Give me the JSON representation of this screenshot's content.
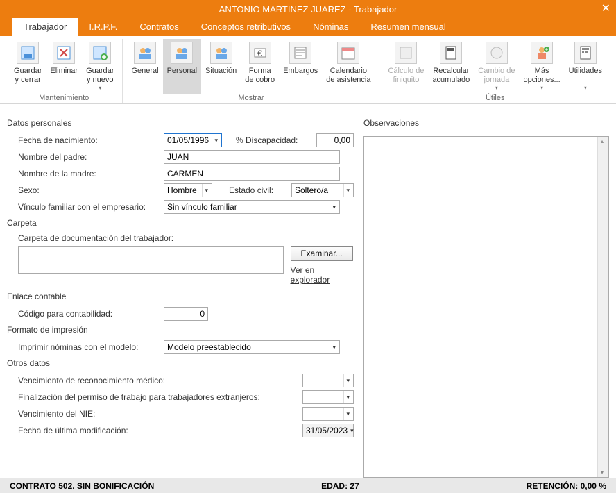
{
  "window": {
    "title": "ANTONIO MARTINEZ JUAREZ - Trabajador"
  },
  "tabs": {
    "trabajador": "Trabajador",
    "irpf": "I.R.P.F.",
    "contratos": "Contratos",
    "conceptos": "Conceptos retributivos",
    "nominas": "Nóminas",
    "resumen": "Resumen mensual"
  },
  "ribbon": {
    "mantenimiento": {
      "label": "Mantenimiento",
      "guardar_cerrar": "Guardar\ny cerrar",
      "eliminar": "Eliminar",
      "guardar_nuevo": "Guardar\ny nuevo"
    },
    "mostrar": {
      "label": "Mostrar",
      "general": "General",
      "personal": "Personal",
      "situacion": "Situación",
      "forma_cobro": "Forma\nde cobro",
      "embargos": "Embargos",
      "calendario": "Calendario\nde asistencia"
    },
    "utiles": {
      "label": "Útiles",
      "calculo": "Cálculo de\nfiniquito",
      "recalcular": "Recalcular\nacumulado",
      "cambio": "Cambio de\njornada",
      "mas": "Más\nopciones...",
      "utilidades": "Utilidades"
    }
  },
  "form": {
    "datos_personales": "Datos personales",
    "fecha_nac_label": "Fecha de nacimiento:",
    "fecha_nac_value": "01/05/1996",
    "discap_label": "% Discapacidad:",
    "discap_value": "0,00",
    "padre_label": "Nombre del padre:",
    "padre_value": "JUAN",
    "madre_label": "Nombre de la madre:",
    "madre_value": "CARMEN",
    "sexo_label": "Sexo:",
    "sexo_value": "Hombre",
    "estado_label": "Estado civil:",
    "estado_value": "Soltero/a",
    "vinculo_label": "Vínculo familiar con el empresario:",
    "vinculo_value": "Sin vínculo familiar",
    "carpeta_title": "Carpeta",
    "carpeta_label": "Carpeta de documentación del trabajador:",
    "examinar": "Examinar...",
    "ver_explorador": "Ver en explorador",
    "enlace_title": "Enlace contable",
    "codigo_label": "Código para contabilidad:",
    "codigo_value": "0",
    "formato_title": "Formato de impresión",
    "imprimir_label": "Imprimir nóminas con el modelo:",
    "imprimir_value": "Modelo preestablecido",
    "otros_title": "Otros datos",
    "venc_medico": "Vencimiento de reconocimiento médico:",
    "fin_permiso": "Finalización del permiso de trabajo para trabajadores extranjeros:",
    "venc_nie": "Vencimiento del NIE:",
    "fecha_mod_label": "Fecha de última modificación:",
    "fecha_mod_value": "31/05/2023",
    "observaciones": "Observaciones"
  },
  "status": {
    "contrato": "CONTRATO 502.  SIN BONIFICACIÓN",
    "edad": "EDAD: 27",
    "retencion": "RETENCIÓN: 0,00 %"
  }
}
